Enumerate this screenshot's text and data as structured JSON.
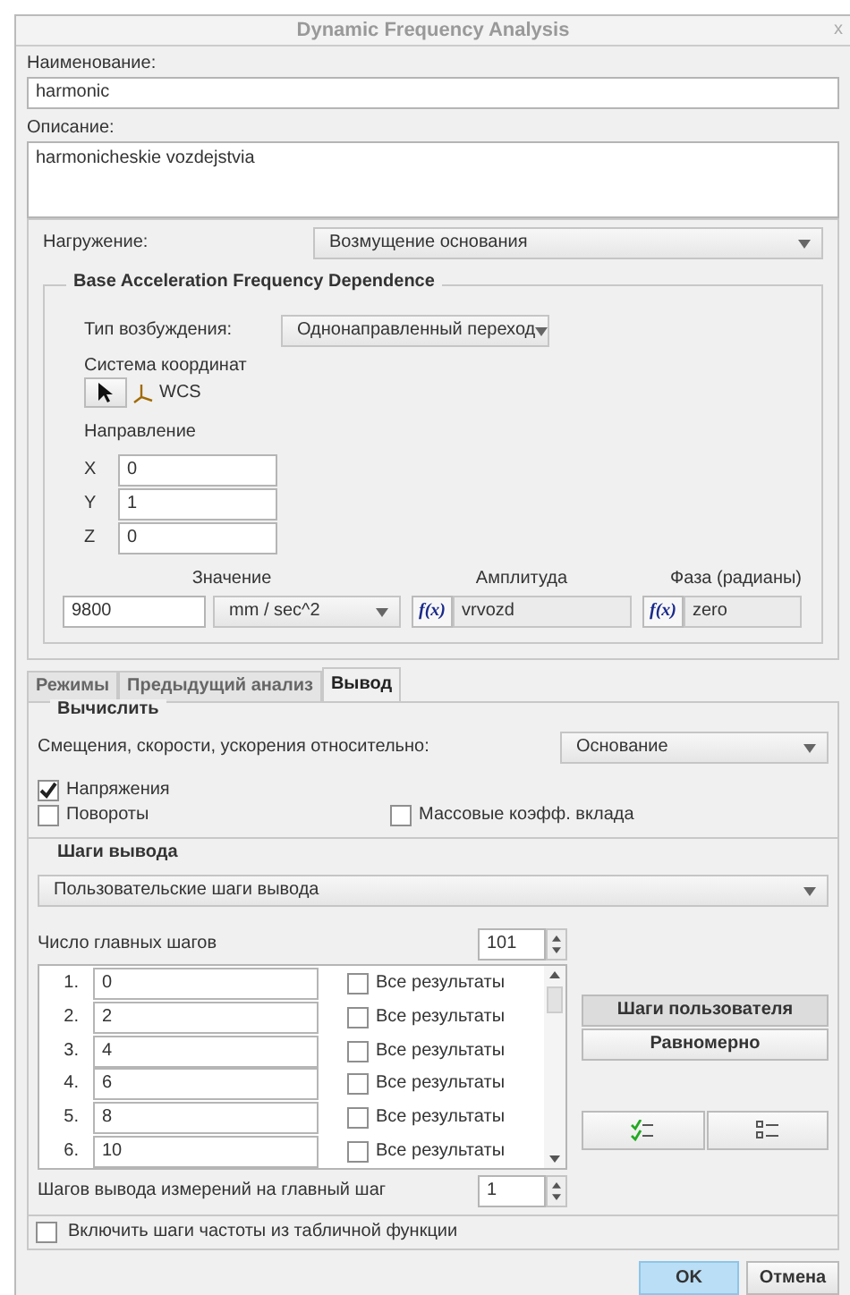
{
  "window": {
    "title": "Dynamic Frequency Analysis",
    "close": "x"
  },
  "name": {
    "label": "Наименование:",
    "value": "harmonic"
  },
  "description": {
    "label": "Описание:",
    "value": "harmonicheskie vozdejstvia"
  },
  "loading": {
    "label": "Нагружение:",
    "value": "Возмущение основания"
  },
  "base_group": {
    "legend": "Base Acceleration Frequency Dependence",
    "excitation": {
      "label": "Тип возбуждения:",
      "value": "Однонаправленный переход"
    },
    "csys": {
      "label": "Система координат",
      "value": "WCS"
    },
    "direction": {
      "label": "Направление",
      "components": [
        {
          "axis": "X",
          "value": "0"
        },
        {
          "axis": "Y",
          "value": "1"
        },
        {
          "axis": "Z",
          "value": "0"
        }
      ]
    },
    "magnitude": {
      "label": "Значение",
      "value": "9800",
      "units": "mm / sec^2"
    },
    "amplitude": {
      "label": "Амплитуда",
      "function_button": "f(x)",
      "value": "vrvozd"
    },
    "phase": {
      "label": "Фаза (радианы)",
      "function_button": "f(x)",
      "value": "zero"
    }
  },
  "tabs": [
    {
      "label": "Режимы",
      "selected": false
    },
    {
      "label": "Предыдущий анализ",
      "selected": false
    },
    {
      "label": "Вывод",
      "selected": true
    }
  ],
  "compute": {
    "legend": "Вычислить",
    "relative": {
      "label": "Смещения, скорости, ускорения относительно:",
      "value": "Основание"
    },
    "option_rows": [
      {
        "items": [
          {
            "label": "Напряжения",
            "checked": true
          }
        ]
      },
      {
        "items": [
          {
            "label": "Повороты",
            "checked": false
          },
          {
            "label": "Массовые коэфф. вклада",
            "checked": false
          }
        ]
      }
    ]
  },
  "output_steps": {
    "legend": "Шаги вывода",
    "mode": "Пользовательские шаги вывода",
    "main_steps": {
      "label": "Число главных шагов",
      "value": "101"
    },
    "steps": [
      {
        "index": "1.",
        "value": "0",
        "all_results": {
          "label": "Все результаты",
          "checked": false
        }
      },
      {
        "index": "2.",
        "value": "2",
        "all_results": {
          "label": "Все результаты",
          "checked": false
        }
      },
      {
        "index": "3.",
        "value": "4",
        "all_results": {
          "label": "Все результаты",
          "checked": false
        }
      },
      {
        "index": "4.",
        "value": "6",
        "all_results": {
          "label": "Все результаты",
          "checked": false
        }
      },
      {
        "index": "5.",
        "value": "8",
        "all_results": {
          "label": "Все результаты",
          "checked": false
        }
      },
      {
        "index": "6.",
        "value": "10",
        "all_results": {
          "label": "Все результаты",
          "checked": false
        }
      }
    ],
    "step_buttons": [
      {
        "label": "Шаги пользователя",
        "selected": true
      },
      {
        "label": "Равномерно",
        "selected": false
      }
    ],
    "per_step": {
      "label": "Шагов вывода измерений на главный шаг",
      "value": "1"
    }
  },
  "include_table": {
    "label": "Включить шаги частоты из табличной функции",
    "checked": false
  },
  "buttons": [
    {
      "label": "OK",
      "kind": "primary"
    },
    {
      "label": "Отмена",
      "kind": "secondary"
    }
  ]
}
